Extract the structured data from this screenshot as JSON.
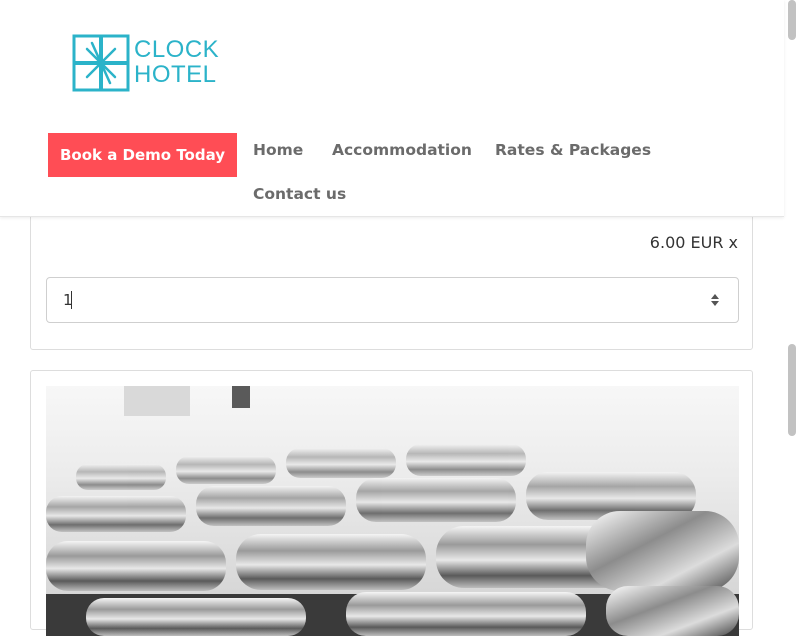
{
  "header": {
    "logo": {
      "line1": "CLOCK",
      "line2": "HOTEL",
      "icon": "clock-hotel-logo-mark",
      "color": "#2bb3c9"
    },
    "cta_label": "Book a Demo Today",
    "cta_color": "#ff4d55",
    "nav": [
      {
        "label": "Home"
      },
      {
        "label": "Accommodation"
      },
      {
        "label": "Rates & Packages"
      },
      {
        "label": "Contact us"
      }
    ]
  },
  "extra_item": {
    "price": "6.00 EUR x",
    "quantity": {
      "value": "1",
      "control_icon": "spinner-arrows-icon"
    }
  },
  "image_card": {
    "photo": "chrome-dumbbells-photo"
  }
}
